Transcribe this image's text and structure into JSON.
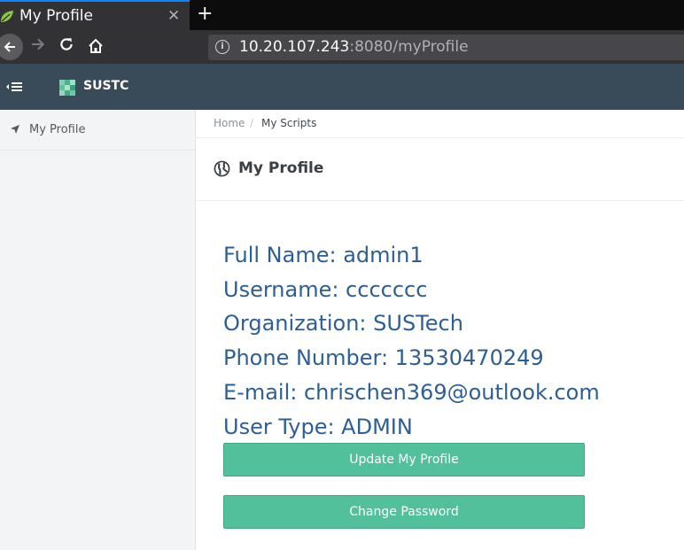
{
  "browser": {
    "tab_title": "My Profile",
    "tab_close": "✕",
    "new_tab": "+",
    "url_host": "10.20.107.243",
    "url_rest": ":8080/myProfile",
    "url_info": "i"
  },
  "header": {
    "brand": "SUSTC"
  },
  "sidebar": {
    "items": [
      {
        "label": "My Profile",
        "icon": "location-arrow-icon"
      }
    ]
  },
  "breadcrumb": {
    "home": "Home",
    "separator": "/",
    "current": "My Scripts"
  },
  "page": {
    "title": "My Profile",
    "icon": "globe-icon"
  },
  "profile": {
    "full_name": "Full Name: admin1",
    "username": "Username: ccccccc",
    "organization": "Organization: SUSTech",
    "phone": "Phone Number: 13530470249",
    "email": "E-mail: chrischen369@outlook.com",
    "user_type": "User Type: ADMIN"
  },
  "actions": {
    "update_label": "Update My Profile",
    "change_password_label": "Change Password"
  },
  "colors": {
    "header_bg": "#394a59",
    "accent_button": "#52c09a",
    "profile_text": "#2d5f96"
  }
}
